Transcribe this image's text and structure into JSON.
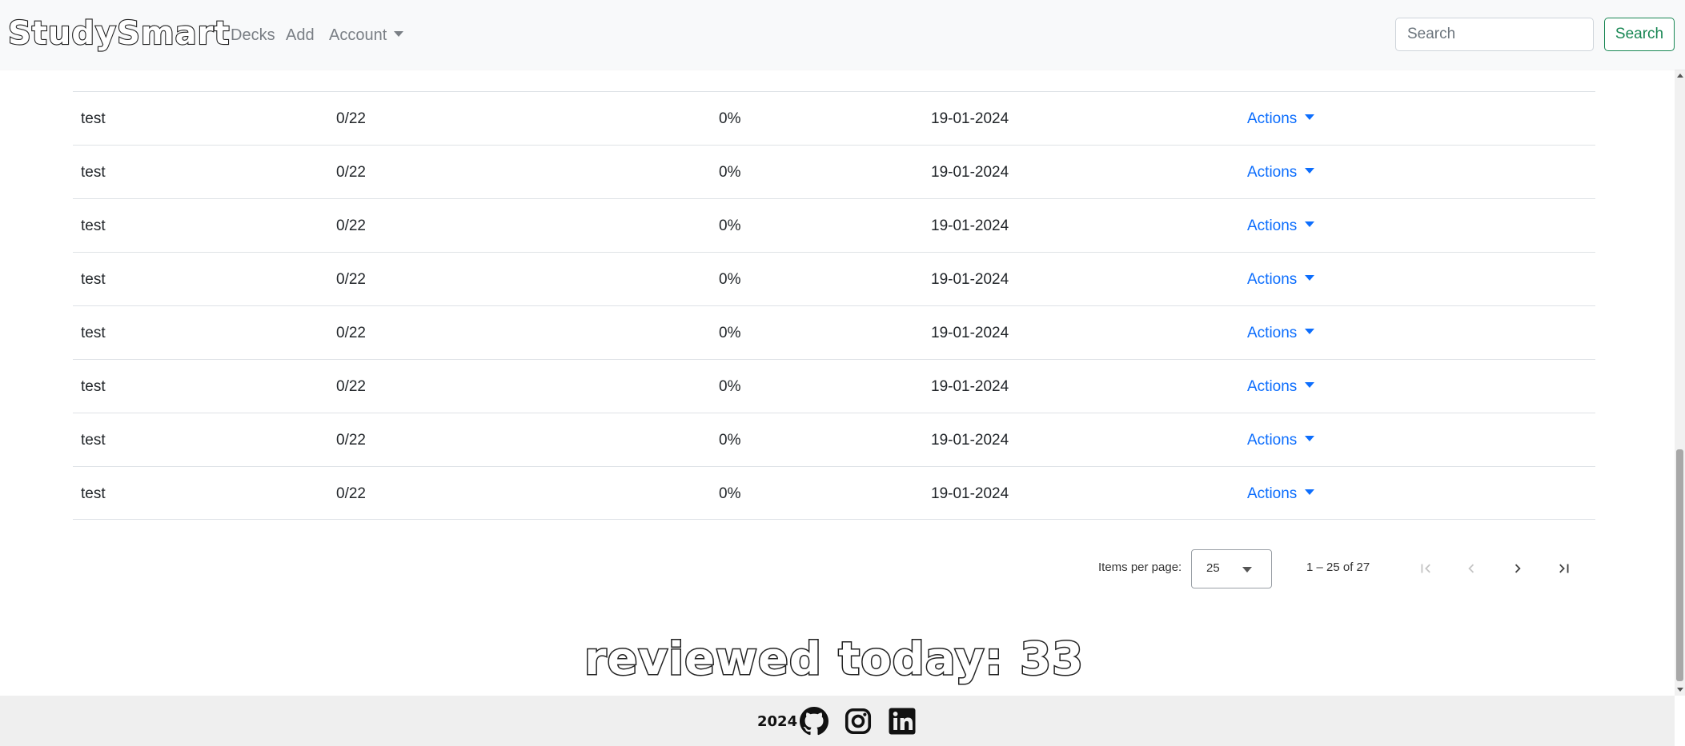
{
  "navbar": {
    "brand": "StudySmart",
    "links": {
      "decks": "Decks",
      "add": "Add",
      "account": "Account"
    },
    "search_placeholder": "Search",
    "search_button": "Search"
  },
  "table": {
    "rows": [
      {
        "name": "test",
        "progress": "0/22",
        "percent": "0%",
        "date": "19-01-2024",
        "actions": "Actions"
      },
      {
        "name": "test",
        "progress": "0/22",
        "percent": "0%",
        "date": "19-01-2024",
        "actions": "Actions"
      },
      {
        "name": "test",
        "progress": "0/22",
        "percent": "0%",
        "date": "19-01-2024",
        "actions": "Actions"
      },
      {
        "name": "test",
        "progress": "0/22",
        "percent": "0%",
        "date": "19-01-2024",
        "actions": "Actions"
      },
      {
        "name": "test",
        "progress": "0/22",
        "percent": "0%",
        "date": "19-01-2024",
        "actions": "Actions"
      },
      {
        "name": "test",
        "progress": "0/22",
        "percent": "0%",
        "date": "19-01-2024",
        "actions": "Actions"
      },
      {
        "name": "test",
        "progress": "0/22",
        "percent": "0%",
        "date": "19-01-2024",
        "actions": "Actions"
      },
      {
        "name": "test",
        "progress": "0/22",
        "percent": "0%",
        "date": "19-01-2024",
        "actions": "Actions"
      }
    ]
  },
  "paginator": {
    "items_per_page_label": "Items per page:",
    "items_per_page_value": "25",
    "range_label": "1 – 25 of 27",
    "icons": [
      "first-page-icon",
      "previous-page-icon",
      "next-page-icon",
      "last-page-icon"
    ]
  },
  "reviewed_today": "reviewed today: 33",
  "footer": {
    "year": "2024",
    "icons": [
      "github-icon",
      "instagram-icon",
      "linkedin-icon"
    ]
  },
  "colors": {
    "link_blue": "#0d6efd",
    "search_green": "#198754",
    "navbar_bg": "#f8f9fa",
    "footer_bg": "#efefef"
  }
}
